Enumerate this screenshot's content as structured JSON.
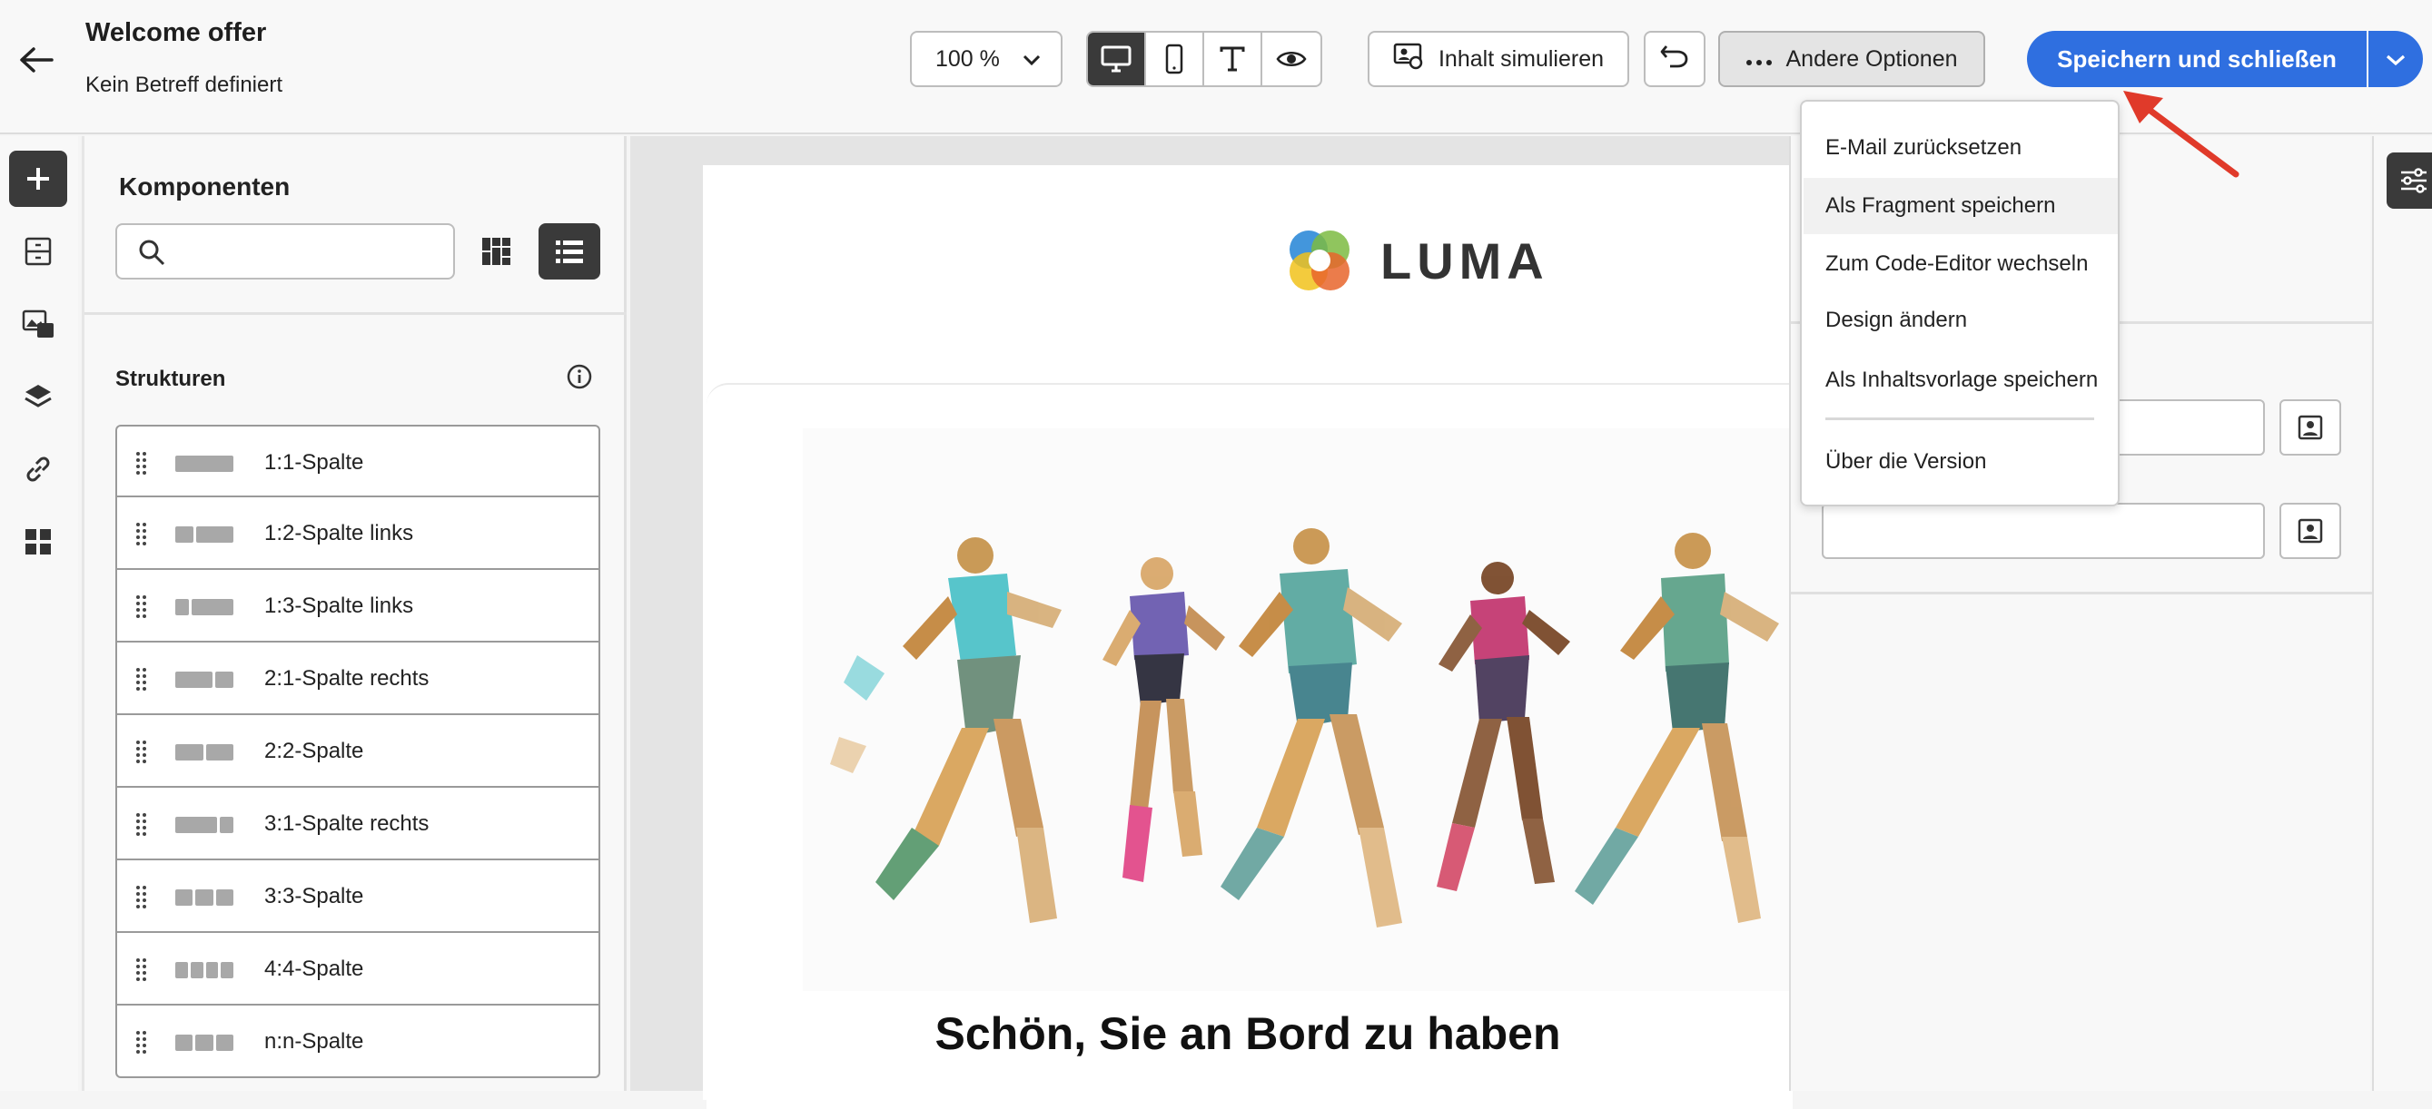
{
  "header": {
    "title": "Welcome offer",
    "subtitle": "Kein Betreff definiert",
    "zoom": "100 %",
    "simulate_label": "Inhalt simulieren",
    "more_options_label": "Andere Optionen",
    "save_label": "Speichern und schließen"
  },
  "view_modes": [
    "desktop",
    "mobile",
    "text",
    "preview"
  ],
  "components_panel": {
    "title": "Komponenten",
    "search_placeholder": "",
    "structures_title": "Strukturen",
    "structures": [
      {
        "label": "1:1-Spalte",
        "cols": [
          4
        ]
      },
      {
        "label": "1:2-Spalte links",
        "cols": [
          1,
          2
        ]
      },
      {
        "label": "1:3-Spalte links",
        "cols": [
          1,
          3
        ]
      },
      {
        "label": "2:1-Spalte rechts",
        "cols": [
          2,
          1
        ]
      },
      {
        "label": "2:2-Spalte",
        "cols": [
          2,
          2
        ]
      },
      {
        "label": "3:1-Spalte rechts",
        "cols": [
          3,
          1
        ]
      },
      {
        "label": "3:3-Spalte",
        "cols": [
          1,
          1,
          1
        ]
      },
      {
        "label": "4:4-Spalte",
        "cols": [
          1,
          1,
          1,
          1
        ]
      },
      {
        "label": "n:n-Spalte",
        "cols": [
          1,
          1,
          1
        ]
      }
    ]
  },
  "email": {
    "logo_text": "LUMA",
    "headline": "Schön, Sie an Bord zu haben"
  },
  "menu": {
    "items": [
      "E-Mail zurücksetzen",
      "Als Fragment speichern",
      "Zum Code-Editor wechseln",
      "Design ändern",
      "Als Inhaltsvorlage speichern",
      "Über die Version"
    ],
    "hovered_index": 1
  },
  "colors": {
    "primary": "#2f6fe0",
    "annotation_arrow": "#e03a2a",
    "dark_button": "#3a3a3a"
  }
}
